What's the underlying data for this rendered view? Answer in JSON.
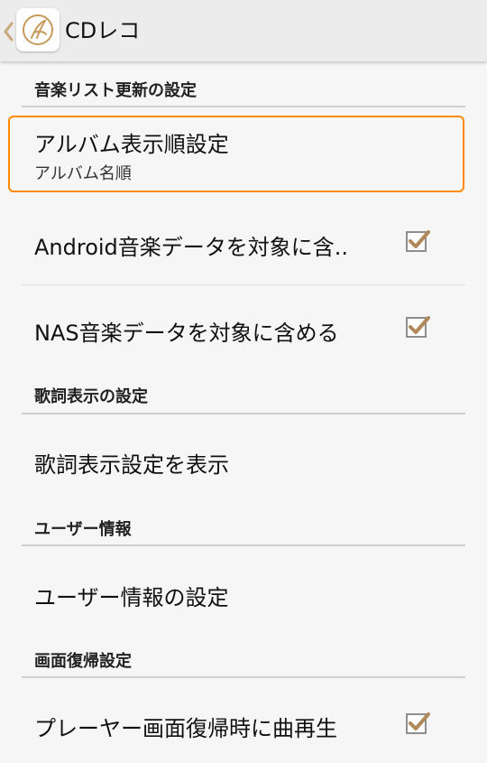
{
  "appbar": {
    "title": "CDレコ",
    "back_icon": "chevron-left-icon",
    "logo_icon": "cd-reco-app-logo-icon"
  },
  "sections": {
    "music_list": {
      "header": "音楽リスト更新の設定"
    },
    "lyrics": {
      "header": "歌詞表示の設定"
    },
    "user": {
      "header": "ユーザー情報"
    },
    "screen_resume": {
      "header": "画面復帰設定"
    }
  },
  "prefs": {
    "album_order": {
      "title": "アルバム表示順設定",
      "summary": "アルバム名順"
    },
    "android_music": {
      "title": "Android音楽データを対象に含..",
      "checked": true
    },
    "nas_music": {
      "title": "NAS音楽データを対象に含める",
      "checked": true
    },
    "lyrics_display": {
      "title": "歌詞表示設定を表示"
    },
    "user_info": {
      "title": "ユーザー情報の設定"
    },
    "resume_play": {
      "title": "プレーヤー画面復帰時に曲再生",
      "checked": true
    }
  },
  "colors": {
    "accent_focus": "#ff8a00",
    "checkbox_check": "#b0885a",
    "logo_gold": "#c79a5c"
  }
}
